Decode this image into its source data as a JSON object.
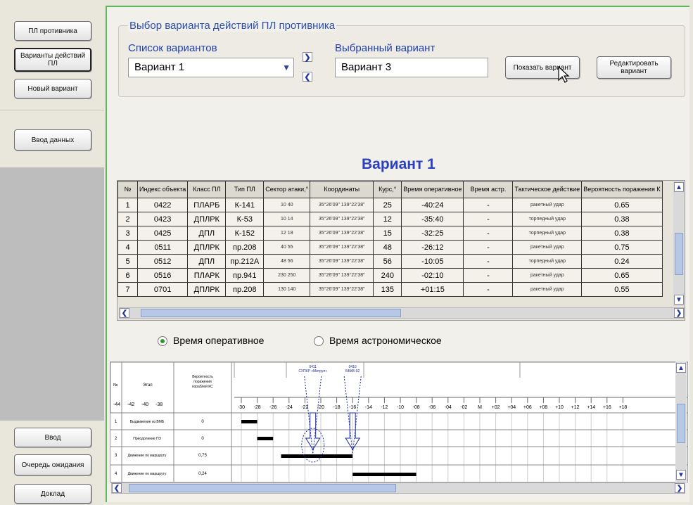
{
  "sidebar": {
    "top_buttons": [
      {
        "label": "ПЛ противника"
      },
      {
        "label": "Варианты действий ПЛ"
      },
      {
        "label": "Новый вариант"
      }
    ],
    "data_entry_button": "Ввод данных",
    "bottom_buttons": [
      {
        "label": "Ввод"
      },
      {
        "label": "Очередь ожидания"
      },
      {
        "label": "Доклад"
      }
    ]
  },
  "selection": {
    "group_title": "Выбор варианта действий ПЛ противника",
    "list_label": "Список вариантов",
    "list_value": "Вариант 1",
    "selected_label": "Выбранный вариант",
    "selected_value": "Вариант 3",
    "show_button": "Показать вариант",
    "edit_button": "Редактировать вариант"
  },
  "variant_title": "Вариант 1",
  "table": {
    "headers": [
      "№",
      "Индекс объекта",
      "Класс ПЛ",
      "Тип ПЛ",
      "Сектор атаки,°",
      "Координаты",
      "Курс,°",
      "Время оперативное",
      "Время астр.",
      "Тактическое действие",
      "Вероятность поражения К"
    ],
    "rows": [
      {
        "n": "1",
        "index": "0422",
        "cls": "ПЛАРБ",
        "type": "К-141",
        "sector": "10 40",
        "coords": "35°26'09\" 139°22'38\"",
        "course": "25",
        "op_time": "-40:24",
        "astro": "-",
        "action": "ракетный удар",
        "prob": "0.65"
      },
      {
        "n": "2",
        "index": "0423",
        "cls": "ДПЛРК",
        "type": "К-53",
        "sector": "10 14",
        "coords": "35°26'09\" 139°22'38\"",
        "course": "12",
        "op_time": "-35:40",
        "astro": "-",
        "action": "торпедный удар",
        "prob": "0.38"
      },
      {
        "n": "3",
        "index": "0425",
        "cls": "ДПЛ",
        "type": "К-152",
        "sector": "12 18",
        "coords": "35°26'09\" 139°22'38\"",
        "course": "15",
        "op_time": "-32:25",
        "astro": "-",
        "action": "торпедный удар",
        "prob": "0.38"
      },
      {
        "n": "4",
        "index": "0511",
        "cls": "ДПЛРК",
        "type": "пр.208",
        "sector": "40 55",
        "coords": "35°26'09\" 139°22'38\"",
        "course": "48",
        "op_time": "-26:12",
        "astro": "-",
        "action": "ракетный удар",
        "prob": "0.75"
      },
      {
        "n": "5",
        "index": "0512",
        "cls": "ДПЛ",
        "type": "пр.212А",
        "sector": "48 56",
        "coords": "35°26'09\" 139°22'38\"",
        "course": "56",
        "op_time": "-10:05",
        "astro": "-",
        "action": "торпедный удар",
        "prob": "0.24"
      },
      {
        "n": "6",
        "index": "0516",
        "cls": "ПЛАРК",
        "type": "пр.941",
        "sector": "230 250",
        "coords": "35°26'09\" 139°22'38\"",
        "course": "240",
        "op_time": "-02:10",
        "astro": "-",
        "action": "ракетный удар",
        "prob": "0.65"
      },
      {
        "n": "7",
        "index": "0701",
        "cls": "ДПЛРК",
        "type": "пр.208",
        "sector": "130 140",
        "coords": "35°26'09\" 139°22'38\"",
        "course": "135",
        "op_time": "+01:15",
        "astro": "-",
        "action": "ракетный удар",
        "prob": "0.55"
      }
    ]
  },
  "radios": {
    "operational": "Время оперативное",
    "astronomical": "Время астрономическое",
    "selected": "operational"
  },
  "gantt": {
    "col_n": "№",
    "col_stage": "Этап",
    "col_prob": "Вероятность поражения кораблей КС",
    "left_axis": [
      "-44",
      "-42",
      "-40",
      "-38"
    ],
    "axis": [
      "-30",
      "-28",
      "-26",
      "-24",
      "-22",
      "-20",
      "-18",
      "-16",
      "-14",
      "-12",
      "-10",
      "-08",
      "-06",
      "-04",
      "-02",
      "М",
      "+02",
      "+04",
      "+06",
      "+08",
      "+10",
      "+12",
      "+14",
      "+16",
      "+18"
    ],
    "markers": [
      {
        "label": "0411 СУПКР «Митрул»",
        "time": -21
      },
      {
        "label": "0416 ББКВ-92",
        "time": -16
      }
    ],
    "rows": [
      {
        "n": "1",
        "stage": "Выдвижение из ВМБ",
        "prob": "0",
        "start": -30,
        "end": -28
      },
      {
        "n": "2",
        "stage": "Преодоление ПЗ",
        "prob": "0",
        "start": -28,
        "end": -26
      },
      {
        "n": "3",
        "stage": "Движение по маршруту",
        "prob": "0,75",
        "start": -25,
        "end": -16
      },
      {
        "n": "4",
        "stage": "Движение по маршруту",
        "prob": "0,24",
        "start": -16,
        "end": -8
      }
    ]
  },
  "colors": {
    "accent_green": "#5db85d",
    "title_blue": "#2b3fc0"
  }
}
